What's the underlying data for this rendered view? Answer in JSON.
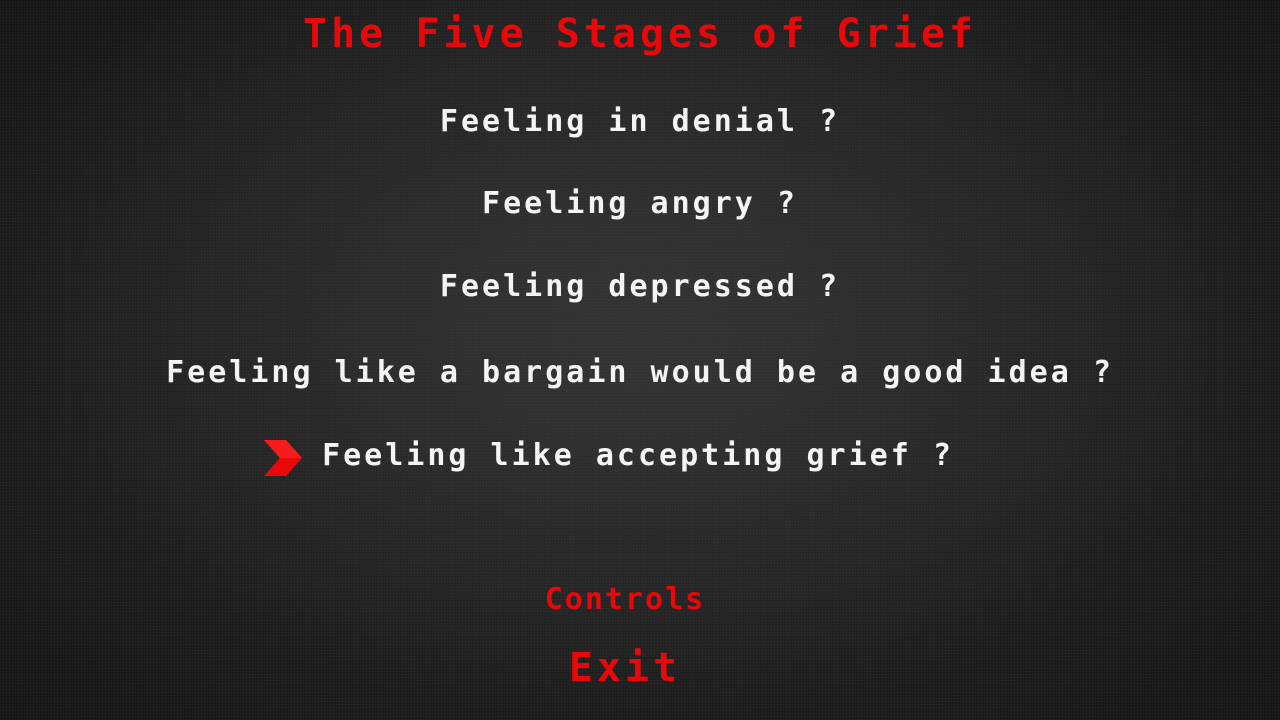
{
  "title": "The Five Stages of Grief",
  "menu": {
    "items": [
      {
        "label": "Feeling in denial ?"
      },
      {
        "label": "Feeling angry ?"
      },
      {
        "label": "Feeling depressed ?"
      },
      {
        "label": "Feeling like a bargain would be a good idea ?"
      },
      {
        "label": "Feeling like accepting grief ?"
      }
    ],
    "selected_index": 4
  },
  "footer": {
    "controls_label": "Controls",
    "exit_label": "Exit"
  },
  "icons": {
    "selector": "chevron-right-icon"
  },
  "colors": {
    "accent": "#e8080a",
    "text": "#f4f4f4",
    "background": "#1a1a1a"
  }
}
